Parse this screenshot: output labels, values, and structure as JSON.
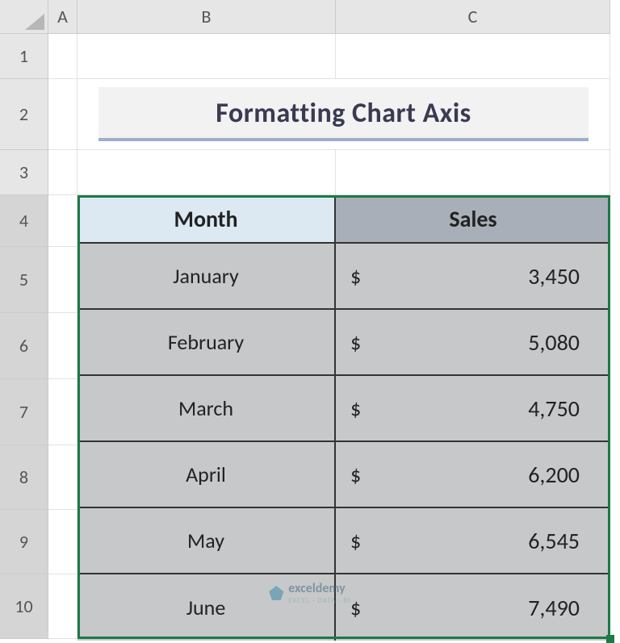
{
  "columns": [
    "A",
    "B",
    "C"
  ],
  "rows": [
    "1",
    "2",
    "3",
    "4",
    "5",
    "6",
    "7",
    "8",
    "9",
    "10"
  ],
  "title": "Formatting Chart Axis",
  "headers": {
    "month": "Month",
    "sales": "Sales"
  },
  "currency_symbol": "$",
  "data": [
    {
      "month": "January",
      "sales": "3,450"
    },
    {
      "month": "February",
      "sales": "5,080"
    },
    {
      "month": "March",
      "sales": "4,750"
    },
    {
      "month": "April",
      "sales": "6,200"
    },
    {
      "month": "May",
      "sales": "6,545"
    },
    {
      "month": "June",
      "sales": "7,490"
    }
  ],
  "watermark": {
    "brand": "exceldemy",
    "tagline": "EXCEL · DATA · BI"
  },
  "chart_data": {
    "type": "table",
    "title": "Formatting Chart Axis",
    "categories": [
      "January",
      "February",
      "March",
      "April",
      "May",
      "June"
    ],
    "series": [
      {
        "name": "Sales",
        "values": [
          3450,
          5080,
          4750,
          6200,
          6545,
          7490
        ]
      }
    ],
    "xlabel": "Month",
    "ylabel": "Sales"
  }
}
